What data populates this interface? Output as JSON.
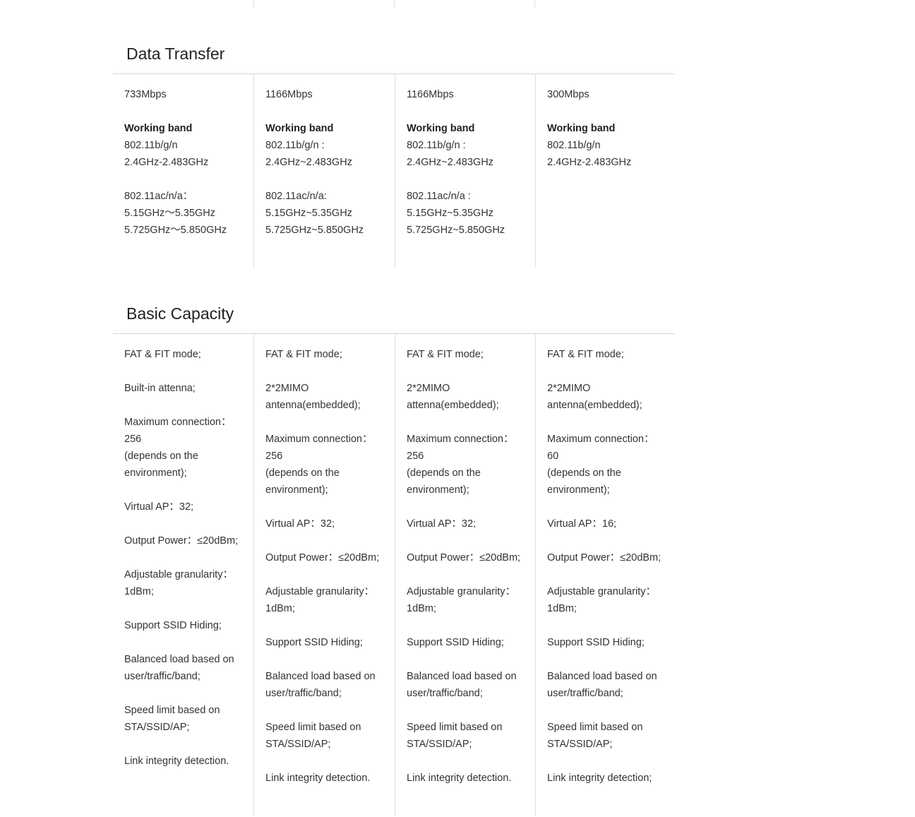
{
  "sections": [
    {
      "title": "Data Transfer",
      "columns": [
        {
          "paragraphs": [
            [
              "733Mbps"
            ],
            [
              "Working band",
              "802.11b/g/n",
              "2.4GHz-2.483GHz"
            ],
            [
              "802.11ac/n/a：",
              "5.15GHz～5.35GHz",
              "5.725GHz～5.850GHz"
            ]
          ]
        },
        {
          "paragraphs": [
            [
              "1166Mbps"
            ],
            [
              "Working band",
              "802.11b/g/n :",
              "2.4GHz~2.483GHz"
            ],
            [
              "802.11ac/n/a:",
              "5.15GHz~5.35GHz",
              "5.725GHz~5.850GHz"
            ]
          ]
        },
        {
          "paragraphs": [
            [
              "1166Mbps"
            ],
            [
              "Working band",
              "802.11b/g/n :",
              "2.4GHz~2.483GHz"
            ],
            [
              "802.11ac/n/a :",
              "5.15GHz~5.35GHz",
              "5.725GHz~5.850GHz"
            ]
          ]
        },
        {
          "paragraphs": [
            [
              "300Mbps"
            ],
            [
              "Working band",
              "802.11b/g/n",
              "2.4GHz-2.483GHz"
            ]
          ]
        }
      ]
    },
    {
      "title": "Basic Capacity",
      "columns": [
        {
          "paragraphs": [
            [
              "FAT & FIT mode;"
            ],
            [
              "Built-in attenna;"
            ],
            [
              "Maximum connection：",
              "256",
              "(depends on the",
              "environment);"
            ],
            [
              "Virtual AP：32;"
            ],
            [
              "Output Power：≤20dBm;"
            ],
            [
              "Adjustable granularity：",
              "1dBm;"
            ],
            [
              "Support SSID Hiding;"
            ],
            [
              "Balanced load based on",
              "user/traffic/band;"
            ],
            [
              "Speed limit based on",
              "STA/SSID/AP;"
            ],
            [
              "Link integrity detection."
            ]
          ]
        },
        {
          "paragraphs": [
            [
              "FAT & FIT mode;"
            ],
            [
              "2*2MIMO",
              "antenna(embedded);"
            ],
            [
              "Maximum connection：",
              "256",
              "(depends on the",
              "environment);"
            ],
            [
              "Virtual AP：32;"
            ],
            [
              "Output Power：≤20dBm;"
            ],
            [
              "Adjustable granularity：",
              "1dBm;"
            ],
            [
              "Support SSID Hiding;"
            ],
            [
              "Balanced load based on",
              "user/traffic/band;"
            ],
            [
              "Speed limit based on",
              "STA/SSID/AP;"
            ],
            [
              "Link integrity detection."
            ]
          ]
        },
        {
          "paragraphs": [
            [
              "FAT & FIT mode;"
            ],
            [
              "2*2MIMO",
              "attenna(embedded);"
            ],
            [
              "Maximum connection：",
              "256",
              "(depends on the",
              "environment);"
            ],
            [
              "Virtual AP：32;"
            ],
            [
              "Output Power：≤20dBm;"
            ],
            [
              "Adjustable granularity：",
              "1dBm;"
            ],
            [
              "Support SSID Hiding;"
            ],
            [
              "Balanced load based on",
              "user/traffic/band;"
            ],
            [
              "Speed limit based on",
              "STA/SSID/AP;"
            ],
            [
              "Link integrity detection."
            ]
          ]
        },
        {
          "paragraphs": [
            [
              "FAT & FIT mode;"
            ],
            [
              "2*2MIMO",
              "antenna(embedded);"
            ],
            [
              "Maximum connection：",
              "60",
              "(depends on the",
              "environment);"
            ],
            [
              "Virtual AP：16;"
            ],
            [
              "Output Power：≤20dBm;"
            ],
            [
              "Adjustable granularity：",
              "1dBm;"
            ],
            [
              "Support SSID Hiding;"
            ],
            [
              "Balanced load based on",
              "user/traffic/band;"
            ],
            [
              "Speed limit based on",
              "STA/SSID/AP;"
            ],
            [
              "Link integrity detection;"
            ]
          ]
        }
      ]
    }
  ]
}
